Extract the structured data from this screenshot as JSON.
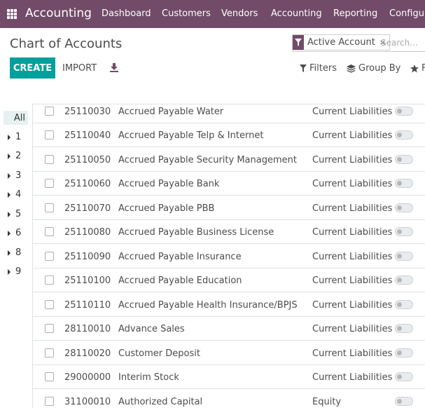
{
  "navbar": {
    "app_name": "Accounting",
    "menus": [
      "Dashboard",
      "Customers",
      "Vendors",
      "Accounting",
      "Reporting",
      "Configur"
    ]
  },
  "control_panel": {
    "title": "Chart of Accounts",
    "facet_label": "Active Account",
    "facet_remove": "×",
    "search_placeholder": "Search...",
    "create_label": "CREATE",
    "import_label": "IMPORT",
    "filters_label": "Filters",
    "groupby_label": "Group By",
    "favorites_label": "F"
  },
  "side_panel": {
    "all_label": "All",
    "items": [
      "1",
      "2",
      "3",
      "4",
      "5",
      "6",
      "8",
      "9"
    ]
  },
  "accounts": [
    {
      "code": "25110030",
      "name": "Accrued Payable Water",
      "type": "Current Liabilities",
      "active": false
    },
    {
      "code": "25110040",
      "name": "Accrued Payable Telp & Internet",
      "type": "Current Liabilities",
      "active": false
    },
    {
      "code": "25110050",
      "name": "Accrued Payable Security Management",
      "type": "Current Liabilities",
      "active": false
    },
    {
      "code": "25110060",
      "name": "Accrued Payable Bank",
      "type": "Current Liabilities",
      "active": false
    },
    {
      "code": "25110070",
      "name": "Accrued Payable PBB",
      "type": "Current Liabilities",
      "active": false
    },
    {
      "code": "25110080",
      "name": "Accrued Payable Business License",
      "type": "Current Liabilities",
      "active": false
    },
    {
      "code": "25110090",
      "name": "Accrued Payable Insurance",
      "type": "Current Liabilities",
      "active": false
    },
    {
      "code": "25110100",
      "name": "Accrued Payable Education",
      "type": "Current Liabilities",
      "active": false
    },
    {
      "code": "25110110",
      "name": "Accrued Payable Health Insurance/BPJS",
      "type": "Current Liabilities",
      "active": false
    },
    {
      "code": "28110010",
      "name": "Advance Sales",
      "type": "Current Liabilities",
      "active": false
    },
    {
      "code": "28110020",
      "name": "Customer Deposit",
      "type": "Current Liabilities",
      "active": false
    },
    {
      "code": "29000000",
      "name": "Interim Stock",
      "type": "Current Liabilities",
      "active": false
    },
    {
      "code": "31100010",
      "name": "Authorized Capital",
      "type": "Equity",
      "active": false
    }
  ],
  "colors": {
    "brand": "#714b67",
    "primary_button": "#00a09d",
    "selected_side_item": "#e6f1f1"
  }
}
